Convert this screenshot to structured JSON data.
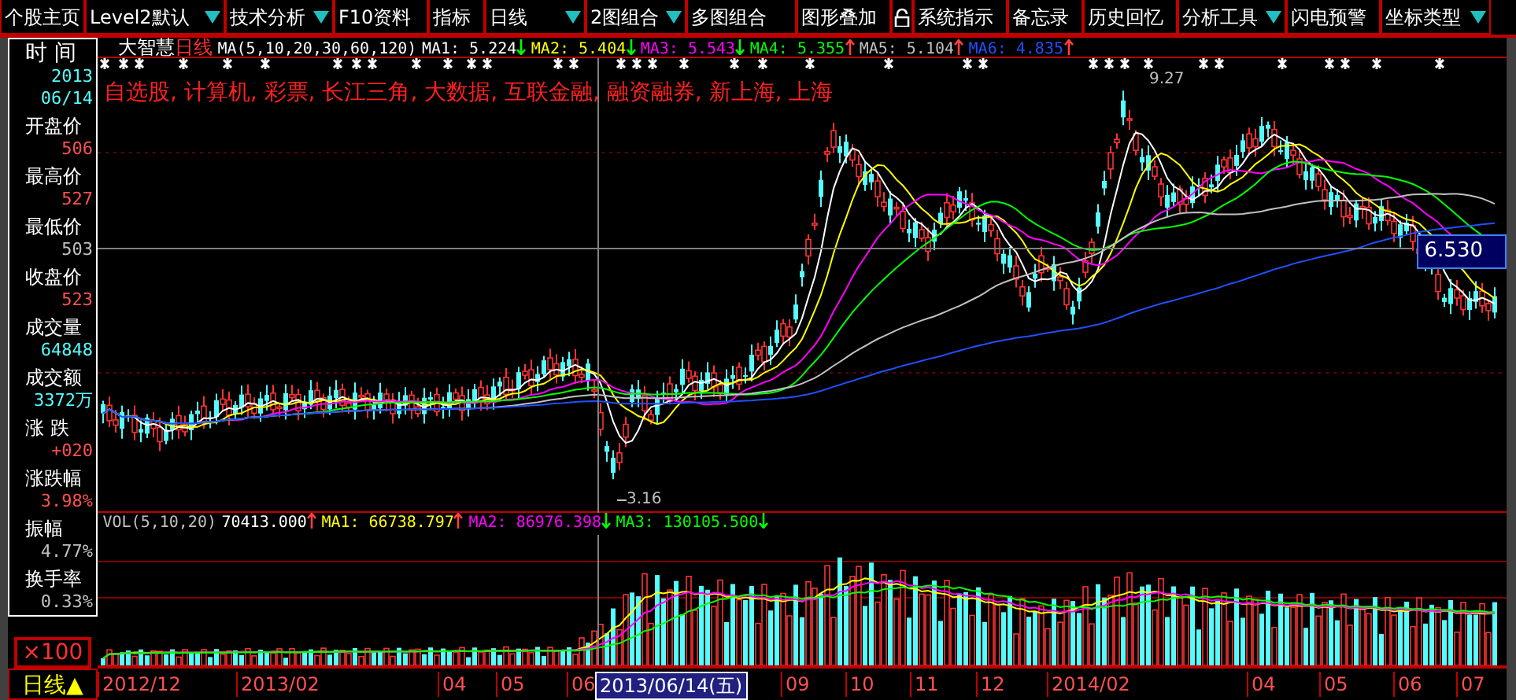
{
  "toolbar": [
    {
      "label": "个股主页",
      "kind": "menu",
      "dropdown": false
    },
    {
      "label": "Level2默认",
      "kind": "menu",
      "dropdown": true
    },
    {
      "label": "技术分析",
      "kind": "menu",
      "dropdown": true
    },
    {
      "label": "F10资料",
      "kind": "menu",
      "dropdown": false
    },
    {
      "label": "指标",
      "kind": "menu",
      "dropdown": false
    },
    {
      "label": "日线",
      "kind": "menu",
      "dropdown": true
    },
    {
      "label": "2图组合",
      "kind": "menu",
      "dropdown": true
    },
    {
      "label": "多图组合",
      "kind": "menu",
      "dropdown": false
    },
    {
      "label": "图形叠加",
      "kind": "menu",
      "dropdown": false
    },
    {
      "kind": "lock"
    },
    {
      "label": "系统指示",
      "kind": "menu",
      "dropdown": false
    },
    {
      "label": "备忘录",
      "kind": "menu",
      "dropdown": false
    },
    {
      "label": "历史回忆",
      "kind": "menu",
      "dropdown": false
    },
    {
      "label": "分析工具",
      "kind": "menu",
      "dropdown": true
    },
    {
      "label": "闪电预警",
      "kind": "menu",
      "dropdown": false
    },
    {
      "label": "坐标类型",
      "kind": "menu",
      "dropdown": true
    }
  ],
  "info_panel": {
    "time_label": "时 间",
    "year": "2013",
    "date": "06/14",
    "rows": [
      {
        "label": "开盘价",
        "value": "506",
        "color": "#ff5050"
      },
      {
        "label": "最高价",
        "value": "527",
        "color": "#ff5050"
      },
      {
        "label": "最低价",
        "value": "503",
        "color": "#c0c0c0"
      },
      {
        "label": "收盘价",
        "value": "523",
        "color": "#ff5050"
      },
      {
        "label": "成交量",
        "value": "64848",
        "color": "#54fcfc"
      },
      {
        "label": "成交额",
        "value": "3372万",
        "color": "#54fcfc"
      },
      {
        "label": "涨 跌",
        "value": "+020",
        "color": "#ff5050"
      },
      {
        "label": "涨跌幅",
        "value": "3.98%",
        "color": "#ff5050"
      },
      {
        "label": "振幅",
        "value": "4.77%",
        "color": "#c0c0c0"
      },
      {
        "label": "换手率",
        "value": "0.33%",
        "color": "#c0c0c0"
      }
    ],
    "scale": "×100",
    "period": "日线▲"
  },
  "price_chart": {
    "source": "大智慧",
    "period": "日线",
    "indicator": "MA(5,10,20,30,60,120)",
    "ma": [
      {
        "label": "MA1:",
        "value": "5.224",
        "rising": false,
        "color": "#ffffff"
      },
      {
        "label": "MA2:",
        "value": "5.404",
        "rising": false,
        "color": "#ffff00"
      },
      {
        "label": "MA3:",
        "value": "5.543",
        "rising": false,
        "color": "#ff00ff"
      },
      {
        "label": "MA4:",
        "value": "5.355",
        "rising": true,
        "color": "#00ff00"
      },
      {
        "label": "MA5:",
        "value": "5.104",
        "rising": true,
        "color": "#c0c0c0"
      },
      {
        "label": "MA6:",
        "value": "4.835",
        "rising": true,
        "color": "#2050ff"
      }
    ],
    "sectors": "自选股, 计算机, 彩票, 长江三角, 大数据, 互联金融, 融资融券, 新上海, 上海",
    "cursor_price": "6.530",
    "low_label": "3.16",
    "high_label": "9.27"
  },
  "volume_chart": {
    "indicator": "VOL(5,10,20)",
    "series": [
      {
        "value": "70413.000",
        "rising": true,
        "color": "#ffffff"
      },
      {
        "label": "MA1:",
        "value": "66738.797",
        "rising": true,
        "color": "#ffff00"
      },
      {
        "label": "MA2:",
        "value": "86976.398",
        "rising": false,
        "color": "#ff00ff"
      },
      {
        "label": "MA3:",
        "value": "130105.500",
        "rising": false,
        "color": "#00ff00"
      }
    ]
  },
  "x_axis": [
    {
      "label": "2012/12",
      "selected": false
    },
    {
      "label": "2013/02",
      "selected": false
    },
    {
      "label": "04",
      "selected": false
    },
    {
      "label": "05",
      "selected": false
    },
    {
      "label": "06",
      "selected": false
    },
    {
      "label": "2013/06/14(五)",
      "selected": true
    },
    {
      "label": "09",
      "selected": false
    },
    {
      "label": "10",
      "selected": false
    },
    {
      "label": "11",
      "selected": false
    },
    {
      "label": "12",
      "selected": false
    },
    {
      "label": "2014/02",
      "selected": false
    },
    {
      "label": "04",
      "selected": false
    },
    {
      "label": "05",
      "selected": false
    },
    {
      "label": "06",
      "selected": false
    },
    {
      "label": "07",
      "selected": false
    }
  ]
}
